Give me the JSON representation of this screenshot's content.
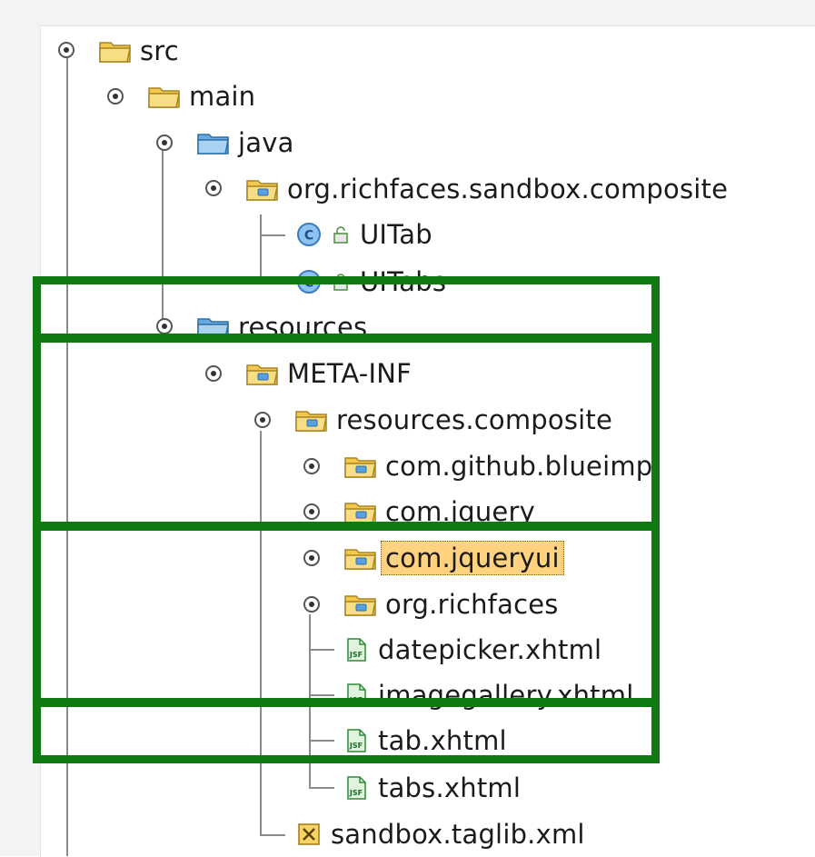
{
  "tree": {
    "src": "src",
    "main": "main",
    "java": "java",
    "pkg_composite": "org.richfaces.sandbox.composite",
    "uitab": "UITab",
    "uitabs": "UITabs",
    "resources": "resources",
    "meta_inf": "META-INF",
    "resources_composite": "resources.composite",
    "com_github_blueimp": "com.github.blueimp",
    "com_jquery": "com.jquery",
    "com_jqueryui": "com.jqueryui",
    "org_richfaces": "org.richfaces",
    "datepicker": "datepicker.xhtml",
    "imagegallery": "imagegallery.xhtml",
    "tab": "tab.xhtml",
    "tabs": "tabs.xhtml",
    "taglib": "sandbox.taglib.xml"
  },
  "colors": {
    "highlight_box": "#0f7a11",
    "selection": "#ffd27f",
    "folder_yellow": "#f4c842",
    "folder_blue": "#7db9ea",
    "jsf_green": "#4caf50"
  },
  "icons": {
    "toggle": "expand-toggle-icon",
    "folder": "folder-icon",
    "source_folder": "source-folder-icon",
    "package": "package-icon",
    "class": "class-icon",
    "lock": "lock-icon",
    "jsf_file": "jsf-file-icon",
    "xml_file": "xml-file-icon"
  }
}
